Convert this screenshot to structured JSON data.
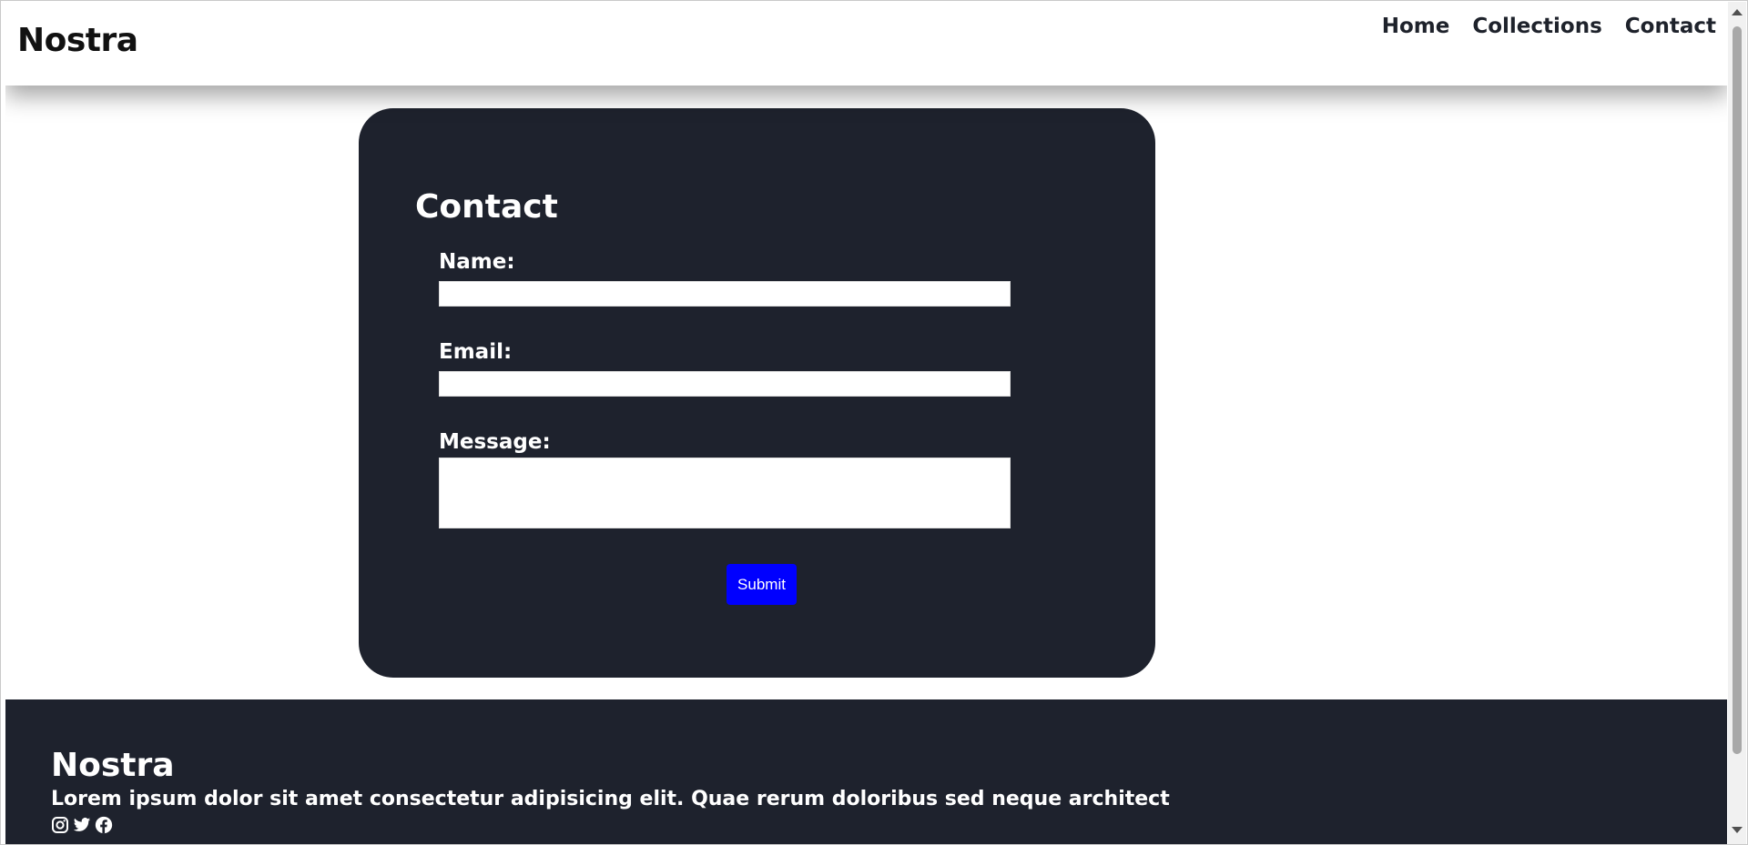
{
  "header": {
    "logo": "Nostra",
    "nav": [
      "Home",
      "Collections",
      "Contact"
    ]
  },
  "contact": {
    "title": "Contact",
    "name_label": "Name:",
    "name_value": "",
    "email_label": "Email:",
    "email_value": "",
    "message_label": "Message:",
    "message_value": "",
    "submit_label": "Submit"
  },
  "footer": {
    "logo": "Nostra",
    "text": "Lorem ipsum dolor sit amet consectetur adipisicing elit. Quae rerum doloribus sed neque architect",
    "social_icons": [
      "instagram-icon",
      "twitter-icon",
      "facebook-icon"
    ]
  },
  "colors": {
    "dark_panel": "#1e222d",
    "submit_button": "#0000ff",
    "text_light": "#ffffff"
  }
}
